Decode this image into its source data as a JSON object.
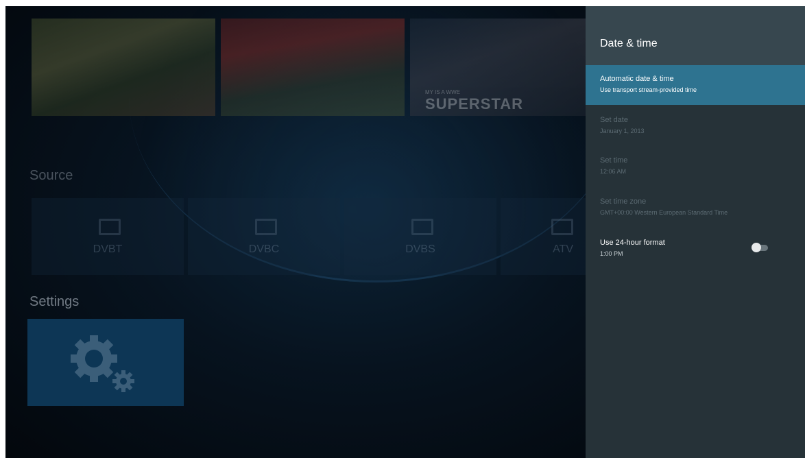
{
  "thumbnails": [
    {
      "caption": ""
    },
    {
      "caption": ""
    },
    {
      "caption_small": "MY IS A WWE",
      "caption": "SUPERSTAR"
    }
  ],
  "launcher": {
    "source_title": "Source",
    "sources": [
      {
        "label": "DVBT",
        "icon": "tv-icon"
      },
      {
        "label": "DVBC",
        "icon": "tv-icon"
      },
      {
        "label": "DVBS",
        "icon": "tv-icon"
      },
      {
        "label": "ATV",
        "icon": "antenna-icon"
      }
    ],
    "settings_title": "Settings",
    "settings_icon": "gear-icon"
  },
  "panel": {
    "title": "Date & time",
    "items": [
      {
        "title": "Automatic date & time",
        "subtitle": "Use transport stream-provided time",
        "state": "selected"
      },
      {
        "title": "Set date",
        "subtitle": "January 1, 2013",
        "state": "disabled"
      },
      {
        "title": "Set time",
        "subtitle": "12:06 AM",
        "state": "disabled"
      },
      {
        "title": "Set time zone",
        "subtitle": "GMT+00:00 Western European Standard Time",
        "state": "disabled"
      },
      {
        "title": "Use 24-hour format",
        "subtitle": "1:00 PM",
        "state": "active",
        "toggle_on": false
      }
    ]
  },
  "colors": {
    "panel_bg": "#263238",
    "panel_header": "#37474f",
    "selected_item": "#2e7390",
    "disabled_text": "#5c6b73"
  }
}
